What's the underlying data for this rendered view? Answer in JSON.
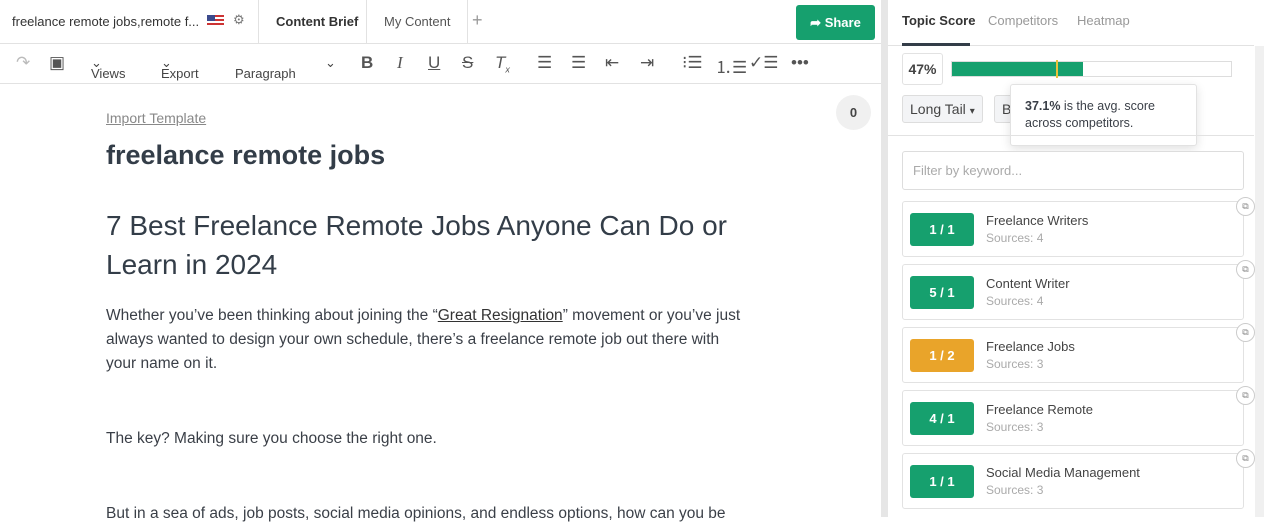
{
  "header": {
    "doc_title": "freelance remote jobs,remote f...",
    "tabs": [
      "Content Brief",
      "My Content"
    ],
    "add_tab": "+",
    "share_label": "Share"
  },
  "toolbar": {
    "views": "Views",
    "export": "Export",
    "paragraph": "Paragraph"
  },
  "editor": {
    "import_template": "Import Template",
    "counter": "0",
    "title": "freelance remote jobs",
    "heading": "7 Best Freelance Remote Jobs Anyone Can Do or Learn in 2024",
    "p1_before": "Whether you’ve been thinking about joining the “",
    "p1_link": "Great Resignation",
    "p1_after": "” movement or you’ve just always wanted to design your own schedule, there’s a freelance remote job out there with your name on it.",
    "p2": "The key? Making sure you choose the right one.",
    "p3": "But in a sea of ads, job posts, social media opinions, and endless options, how can you be"
  },
  "panel": {
    "tabs": [
      "Topic Score",
      "Competitors",
      "Heatmap"
    ],
    "score": "47%",
    "score_value": 47,
    "avg_value": 37.1,
    "filter_select": "Long Tail",
    "second_select": "B",
    "tooltip_bold": "37.1%",
    "tooltip_text": " is the avg. score across competitors.",
    "filter_placeholder": "Filter by keyword...",
    "colors": {
      "green": "#16a06e",
      "orange": "#e9a42a",
      "avg_marker": "#e9c23a"
    },
    "keywords": [
      {
        "badge": "1 / 1",
        "name": "Freelance Writers",
        "sources": "Sources: 4",
        "status": "green"
      },
      {
        "badge": "5 / 1",
        "name": "Content Writer",
        "sources": "Sources: 4",
        "status": "green"
      },
      {
        "badge": "1 / 2",
        "name": "Freelance Jobs",
        "sources": "Sources: 3",
        "status": "orange"
      },
      {
        "badge": "4 / 1",
        "name": "Freelance Remote",
        "sources": "Sources: 3",
        "status": "green"
      },
      {
        "badge": "1 / 1",
        "name": "Social Media Management",
        "sources": "Sources: 3",
        "status": "green"
      }
    ]
  }
}
